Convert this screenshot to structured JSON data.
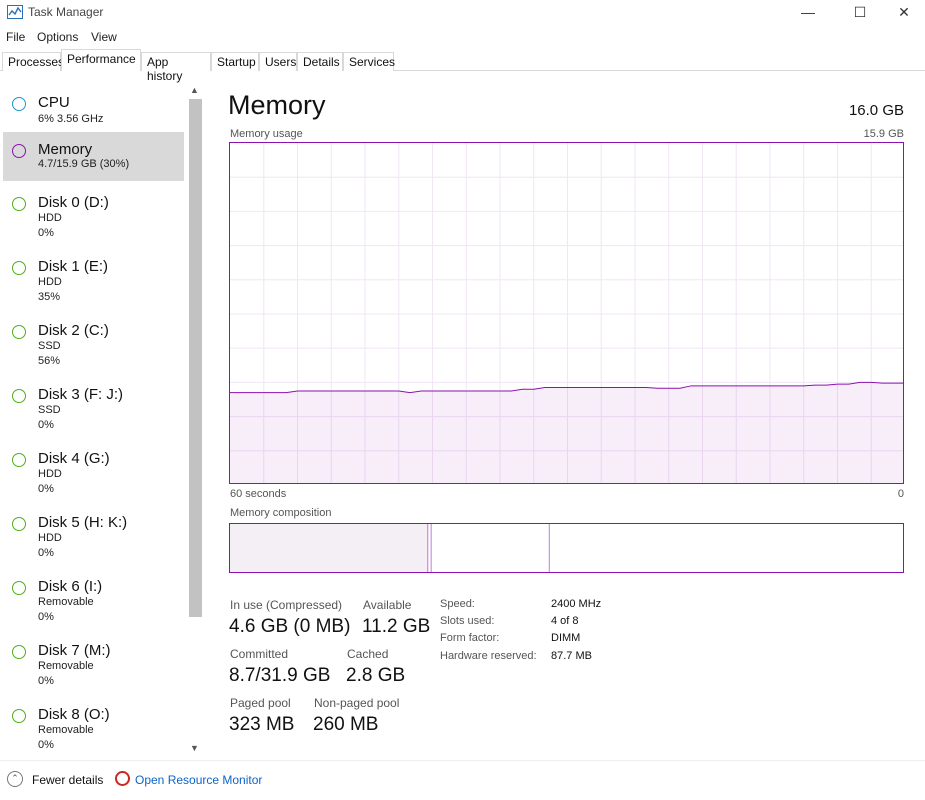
{
  "window": {
    "title": "Task Manager",
    "minimize_glyph": "—",
    "maximize_glyph": "☐",
    "close_glyph": "✕"
  },
  "menu": [
    "File",
    "Options",
    "View"
  ],
  "tabs": [
    {
      "label": "Processes"
    },
    {
      "label": "Performance",
      "active": true
    },
    {
      "label": "App history"
    },
    {
      "label": "Startup"
    },
    {
      "label": "Users"
    },
    {
      "label": "Details"
    },
    {
      "label": "Services"
    }
  ],
  "sidebar": {
    "items": [
      {
        "title": "CPU",
        "lines": [
          "6%  3.56 GHz"
        ],
        "color": "#1799c6"
      },
      {
        "title": "Memory",
        "lines": [
          "4.7/15.9 GB (30%)"
        ],
        "color": "#8b12ae",
        "selected": true
      },
      {
        "title": "Disk 0 (D:)",
        "lines": [
          "HDD",
          "0%"
        ],
        "color": "#4caf1a"
      },
      {
        "title": "Disk 1 (E:)",
        "lines": [
          "HDD",
          "35%"
        ],
        "color": "#4caf1a"
      },
      {
        "title": "Disk 2 (C:)",
        "lines": [
          "SSD",
          "56%"
        ],
        "color": "#4caf1a"
      },
      {
        "title": "Disk 3 (F: J:)",
        "lines": [
          "SSD",
          "0%"
        ],
        "color": "#4caf1a"
      },
      {
        "title": "Disk 4 (G:)",
        "lines": [
          "HDD",
          "0%"
        ],
        "color": "#4caf1a"
      },
      {
        "title": "Disk 5 (H: K:)",
        "lines": [
          "HDD",
          "0%"
        ],
        "color": "#4caf1a"
      },
      {
        "title": "Disk 6 (I:)",
        "lines": [
          "Removable",
          "0%"
        ],
        "color": "#4caf1a"
      },
      {
        "title": "Disk 7 (M:)",
        "lines": [
          "Removable",
          "0%"
        ],
        "color": "#4caf1a"
      },
      {
        "title": "Disk 8 (O:)",
        "lines": [
          "Removable",
          "0%"
        ],
        "color": "#4caf1a"
      }
    ]
  },
  "panel": {
    "title": "Memory",
    "total": "16.0 GB",
    "usage_label": "Memory usage",
    "usage_max": "15.9 GB",
    "time_left": "60 seconds",
    "time_right": "0",
    "composition_label": "Memory composition",
    "accent_color": "#8b12ae",
    "usage_series": [
      0.27,
      0.27,
      0.27,
      0.27,
      0.27,
      0.27,
      0.275,
      0.275,
      0.275,
      0.275,
      0.275,
      0.275,
      0.275,
      0.275,
      0.275,
      0.275,
      0.27,
      0.275,
      0.275,
      0.275,
      0.275,
      0.275,
      0.275,
      0.275,
      0.275,
      0.275,
      0.28,
      0.28,
      0.285,
      0.285,
      0.285,
      0.285,
      0.285,
      0.285,
      0.285,
      0.285,
      0.285,
      0.285,
      0.283,
      0.283,
      0.283,
      0.29,
      0.29,
      0.29,
      0.29,
      0.29,
      0.29,
      0.29,
      0.29,
      0.29,
      0.29,
      0.29,
      0.292,
      0.292,
      0.295,
      0.295,
      0.3,
      0.3,
      0.298,
      0.298,
      0.298
    ],
    "composition": {
      "in_use": 0.293,
      "modified": 0.005,
      "standby": 0.175
    },
    "stats": {
      "in_use_label": "In use (Compressed)",
      "in_use_value": "4.6 GB (0 MB)",
      "available_label": "Available",
      "available_value": "11.2 GB",
      "committed_label": "Committed",
      "committed_value": "8.7/31.9 GB",
      "cached_label": "Cached",
      "cached_value": "2.8 GB",
      "paged_label": "Paged pool",
      "paged_value": "323 MB",
      "nonpaged_label": "Non-paged pool",
      "nonpaged_value": "260 MB"
    },
    "specs": [
      {
        "label": "Speed:",
        "value": "2400 MHz"
      },
      {
        "label": "Slots used:",
        "value": "4 of 8"
      },
      {
        "label": "Form factor:",
        "value": "DIMM"
      },
      {
        "label": "Hardware reserved:",
        "value": "87.7 MB"
      }
    ]
  },
  "footer": {
    "fewer_details": "Fewer details",
    "resource_monitor": "Open Resource Monitor"
  }
}
